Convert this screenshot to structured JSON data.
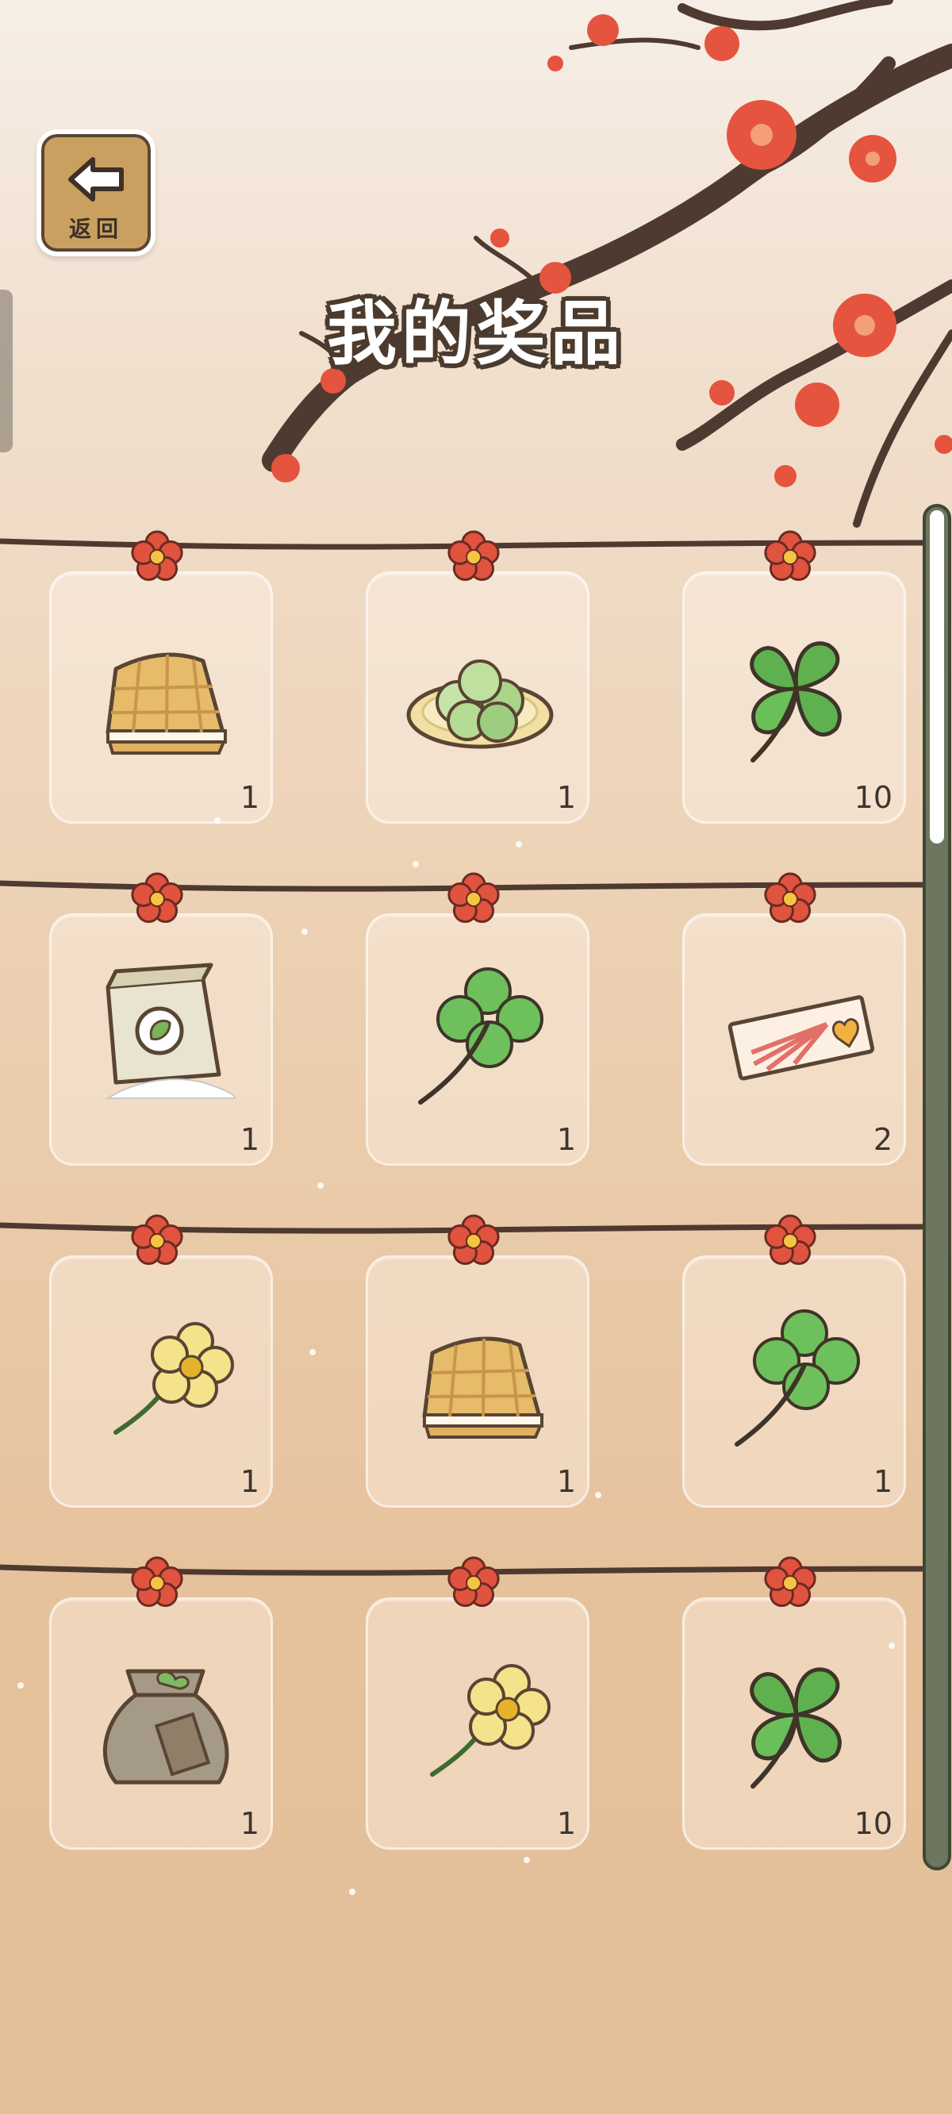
{
  "header": {
    "back_label": "返回",
    "title": "我的奖品"
  },
  "items": [
    {
      "icon": "waffle-icon",
      "count": "1"
    },
    {
      "icon": "dumplings-plate-icon",
      "count": "1"
    },
    {
      "icon": "three-leaf-clover-icon",
      "count": "10"
    },
    {
      "icon": "flour-bag-icon",
      "count": "1"
    },
    {
      "icon": "four-leaf-clover-icon",
      "count": "1"
    },
    {
      "icon": "ticket-icon",
      "count": "2"
    },
    {
      "icon": "yellow-flower-icon",
      "count": "1"
    },
    {
      "icon": "waffle-icon",
      "count": "1"
    },
    {
      "icon": "four-leaf-clover-icon",
      "count": "1"
    },
    {
      "icon": "seed-bag-icon",
      "count": "1"
    },
    {
      "icon": "yellow-flower-icon",
      "count": "1"
    },
    {
      "icon": "three-leaf-clover-icon",
      "count": "10"
    }
  ],
  "colors": {
    "blossom": "#e0533f",
    "clover": "#62b252",
    "frame": "#4b3b2e",
    "scrollbar": "#6d7760"
  }
}
